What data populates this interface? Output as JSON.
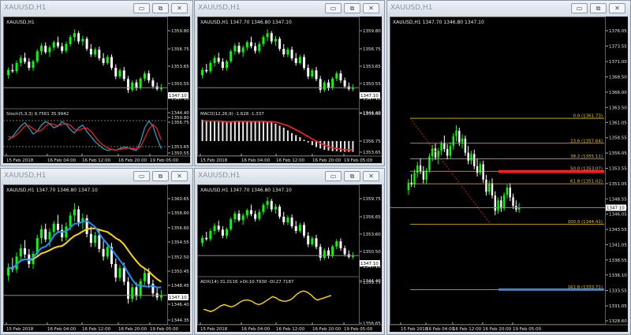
{
  "window_buttons": {
    "minimize": "▭",
    "restore": "⧉",
    "close": "✕"
  },
  "colors": {
    "bull": "#00ff00",
    "bear": "#ffffff",
    "grid": "#606060",
    "fib": "#e6c400",
    "sma_fast": "#1e90ff",
    "sma_slow": "#ffd700",
    "signal": "#ff2020",
    "adx": "#ffd700"
  },
  "windows": [
    {
      "title": "XAUUSD,H1",
      "legend": "XAUUSD,H1",
      "price_ticks": [
        "1359.80",
        "1356.75",
        "1353.65",
        "1350.55",
        "1347.10",
        "1344.40"
      ],
      "current_price": "1347.10",
      "sub_legend": "Stoch(5,3,3) 9.7561 35.9942",
      "sub_ticks": [
        "100",
        "80",
        "20",
        "0"
      ],
      "time_ticks": [
        "15 Feb 2018",
        "16 Feb 04:00",
        "16 Feb 12:00",
        "16 Feb 20:00",
        "19 Feb 05:00"
      ]
    },
    {
      "title": "XAUUSD,H1",
      "legend": "XAUUSD,H1  1347.70 1346.80 1347.10",
      "price_ticks": [
        "1359.80",
        "1356.75",
        "1353.65",
        "1350.55",
        "1347.10",
        "1344.40"
      ],
      "current_price": "1347.10",
      "sub_legend": "MACD(12,26,9) -1.628 -1.337",
      "sub_ticks": [
        "4.096",
        "0.00",
        "-1.901"
      ],
      "time_ticks": [
        "15 Feb 2018",
        "16 Feb 04:00",
        "16 Feb 12:00",
        "16 Feb 20:00",
        "19 Feb 05:00"
      ]
    },
    {
      "title": "XAUUSD,H1",
      "legend": "XAUUSD,H1  1347.70 1346.80 1347.10",
      "price_ticks": [
        "1360.65",
        "1358.60",
        "1356.60",
        "1354.55",
        "1352.50",
        "1350.45",
        "1348.45",
        "1347.10",
        "1346.40",
        "1344.35"
      ],
      "current_price": "1347.10",
      "time_ticks": [
        "15 Feb 2018",
        "16 Feb 04:00",
        "16 Feb 12:00",
        "16 Feb 20:00",
        "19 Feb 05:00"
      ]
    },
    {
      "title": "XAUUSD,H1",
      "legend": "XAUUSD,H1  1347.70 1346.80 1347.10",
      "price_ticks": [
        "1359.75",
        "1356.65",
        "1353.60",
        "1350.50",
        "1347.10",
        "1344.40"
      ],
      "current_price": "1347.10",
      "sub_legend": "ADX(14) 31.0116 +DI:10.7930 -DI:27.7187",
      "sub_ticks": [
        "40",
        "5"
      ],
      "time_ticks": [
        "15 Feb 2018",
        "16 Feb 04:00",
        "16 Feb 12:00",
        "16 Feb 20:00",
        "19 Feb 05:00"
      ]
    },
    {
      "title": "XAUUSD,H1",
      "legend": "XAUUSD,H1  1347.70 1346.80 1347.10",
      "price_ticks": [
        "1376.05",
        "1373.55",
        "1371.00",
        "1368.50",
        "1366.00",
        "1363.50",
        "1361.05",
        "1358.55",
        "1356.05",
        "1353.55",
        "1351.05",
        "1348.55",
        "1347.10",
        "1346.05",
        "1343.55",
        "1341.05",
        "1338.55",
        "1336.10",
        "1333.55",
        "1331.05",
        "1328.60"
      ],
      "current_price": "1347.10",
      "fib_labels": [
        "0.0 (1361.73)",
        "23.6 (1357.64)",
        "38.2 (1355.11)",
        "50.0 (1353.07)",
        "61.8 (1351.02)",
        "100.0 (1344.41)",
        "161.8 (1333.71)"
      ],
      "time_ticks": [
        "15 Feb 2018",
        "16 Feb 04:00",
        "16 Feb 12:00",
        "16 Feb 20:00",
        "19 Feb 05:00"
      ]
    }
  ],
  "candles": [
    [
      1350.0,
      1351.8,
      1349.2,
      1351.2
    ],
    [
      1351.2,
      1352.6,
      1350.5,
      1350.9
    ],
    [
      1350.9,
      1353.4,
      1350.4,
      1352.8
    ],
    [
      1352.8,
      1354.6,
      1352.0,
      1354.0
    ],
    [
      1354.0,
      1355.2,
      1352.6,
      1353.1
    ],
    [
      1353.1,
      1353.9,
      1351.1,
      1351.7
    ],
    [
      1351.7,
      1353.6,
      1351.0,
      1353.2
    ],
    [
      1353.2,
      1356.0,
      1352.8,
      1355.5
    ],
    [
      1355.5,
      1357.4,
      1354.7,
      1356.8
    ],
    [
      1356.8,
      1357.6,
      1354.9,
      1355.3
    ],
    [
      1355.3,
      1356.9,
      1354.2,
      1356.4
    ],
    [
      1356.4,
      1358.0,
      1355.7,
      1357.6
    ],
    [
      1357.6,
      1358.9,
      1356.2,
      1356.7
    ],
    [
      1356.7,
      1357.5,
      1355.0,
      1355.6
    ],
    [
      1355.6,
      1357.8,
      1355.1,
      1357.2
    ],
    [
      1357.2,
      1359.3,
      1356.6,
      1358.8
    ],
    [
      1358.8,
      1360.6,
      1357.9,
      1359.7
    ],
    [
      1359.7,
      1360.2,
      1357.2,
      1357.8
    ],
    [
      1357.8,
      1359.1,
      1356.8,
      1358.4
    ],
    [
      1358.4,
      1358.9,
      1355.6,
      1356.1
    ],
    [
      1356.1,
      1357.2,
      1354.2,
      1354.8
    ],
    [
      1354.8,
      1356.4,
      1354.2,
      1355.9
    ],
    [
      1355.9,
      1356.6,
      1353.4,
      1353.9
    ],
    [
      1353.9,
      1355.1,
      1352.2,
      1352.8
    ],
    [
      1352.8,
      1354.7,
      1352.4,
      1354.2
    ],
    [
      1354.2,
      1354.8,
      1351.2,
      1351.7
    ],
    [
      1351.7,
      1352.5,
      1349.1,
      1349.7
    ],
    [
      1349.7,
      1351.6,
      1349.2,
      1351.1
    ],
    [
      1351.1,
      1351.9,
      1348.6,
      1349.1
    ],
    [
      1349.1,
      1349.8,
      1345.9,
      1346.6
    ],
    [
      1346.6,
      1348.8,
      1346.1,
      1348.3
    ],
    [
      1348.3,
      1349.0,
      1346.4,
      1347.0
    ],
    [
      1347.0,
      1349.6,
      1346.6,
      1349.2
    ],
    [
      1349.2,
      1350.9,
      1348.6,
      1350.4
    ],
    [
      1350.4,
      1351.1,
      1348.2,
      1348.8
    ],
    [
      1348.8,
      1349.4,
      1346.9,
      1347.4
    ],
    [
      1347.4,
      1348.3,
      1346.4,
      1346.8
    ],
    [
      1346.8,
      1347.9,
      1346.3,
      1347.1
    ]
  ]
}
